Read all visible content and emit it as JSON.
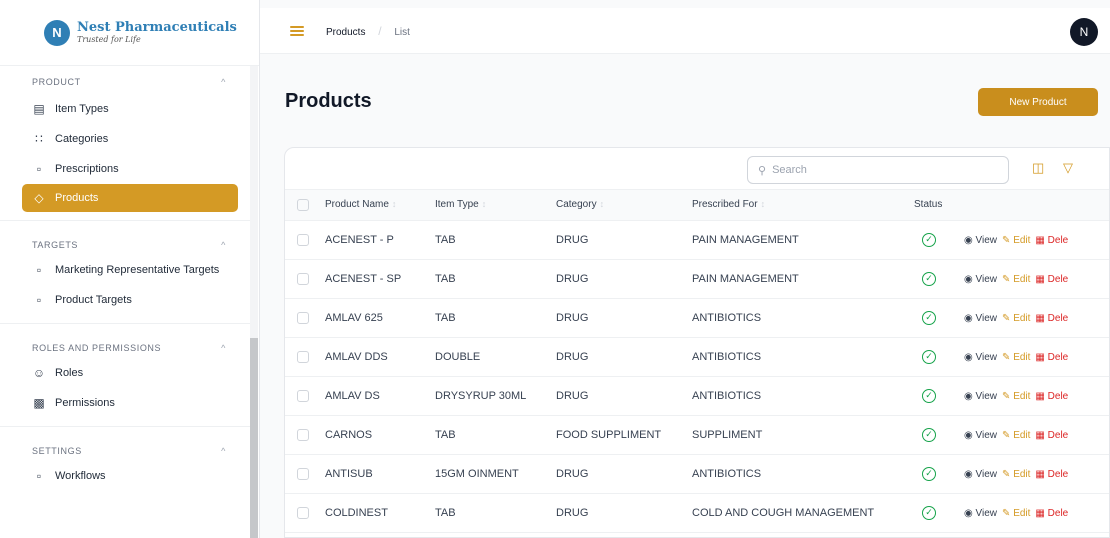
{
  "brand": {
    "name": "Nest Pharmaceuticals",
    "tagline": "Trusted for Life",
    "logo_letter": "N"
  },
  "sidebar": {
    "groups": [
      {
        "title": "PRODUCT",
        "items": [
          {
            "label": "Item Types",
            "icon": "item-types-icon"
          },
          {
            "label": "Categories",
            "icon": "categories-icon"
          },
          {
            "label": "Prescriptions",
            "icon": "prescriptions-icon"
          },
          {
            "label": "Products",
            "icon": "products-icon",
            "active": true
          }
        ]
      },
      {
        "title": "TARGETS",
        "items": [
          {
            "label": "Marketing Representative Targets",
            "icon": "targets-icon"
          },
          {
            "label": "Product Targets",
            "icon": "targets-icon"
          }
        ]
      },
      {
        "title": "ROLES AND PERMISSIONS",
        "items": [
          {
            "label": "Roles",
            "icon": "roles-icon"
          },
          {
            "label": "Permissions",
            "icon": "lock-icon"
          }
        ]
      },
      {
        "title": "SETTINGS",
        "items": [
          {
            "label": "Workflows",
            "icon": "workflows-icon"
          }
        ]
      }
    ]
  },
  "topbar": {
    "breadcrumb_root": "Products",
    "breadcrumb_current": "List",
    "avatar_initial": "N"
  },
  "page": {
    "title": "Products",
    "new_button": "New Product"
  },
  "search": {
    "placeholder": "Search"
  },
  "table": {
    "headers": {
      "name": "Product Name",
      "type": "Item Type",
      "category": "Category",
      "prescribed": "Prescribed For",
      "status": "Status"
    },
    "actions": {
      "view": "View",
      "edit": "Edit",
      "delete": "Dele"
    },
    "rows": [
      {
        "name": "ACENEST - P",
        "type": "TAB",
        "category": "DRUG",
        "prescribed": "PAIN MANAGEMENT"
      },
      {
        "name": "ACENEST - SP",
        "type": "TAB",
        "category": "DRUG",
        "prescribed": "PAIN MANAGEMENT"
      },
      {
        "name": "AMLAV 625",
        "type": "TAB",
        "category": "DRUG",
        "prescribed": "ANTIBIOTICS"
      },
      {
        "name": "AMLAV DDS",
        "type": "DOUBLE",
        "category": "DRUG",
        "prescribed": "ANTIBIOTICS"
      },
      {
        "name": "AMLAV DS",
        "type": "DRYSYRUP 30ML",
        "category": "DRUG",
        "prescribed": "ANTIBIOTICS"
      },
      {
        "name": "CARNOS",
        "type": "TAB",
        "category": "FOOD SUPPLIMENT",
        "prescribed": "SUPPLIMENT"
      },
      {
        "name": "ANTISUB",
        "type": "15GM OINMENT",
        "category": "DRUG",
        "prescribed": "ANTIBIOTICS"
      },
      {
        "name": "COLDINEST",
        "type": "TAB",
        "category": "DRUG",
        "prescribed": "COLD AND COUGH MANAGEMENT"
      }
    ]
  },
  "colors": {
    "accent": "#d49a25",
    "button": "#c98e1d",
    "brand": "#2f7fb5",
    "status_ok": "#16a34a",
    "danger": "#dc2626"
  }
}
